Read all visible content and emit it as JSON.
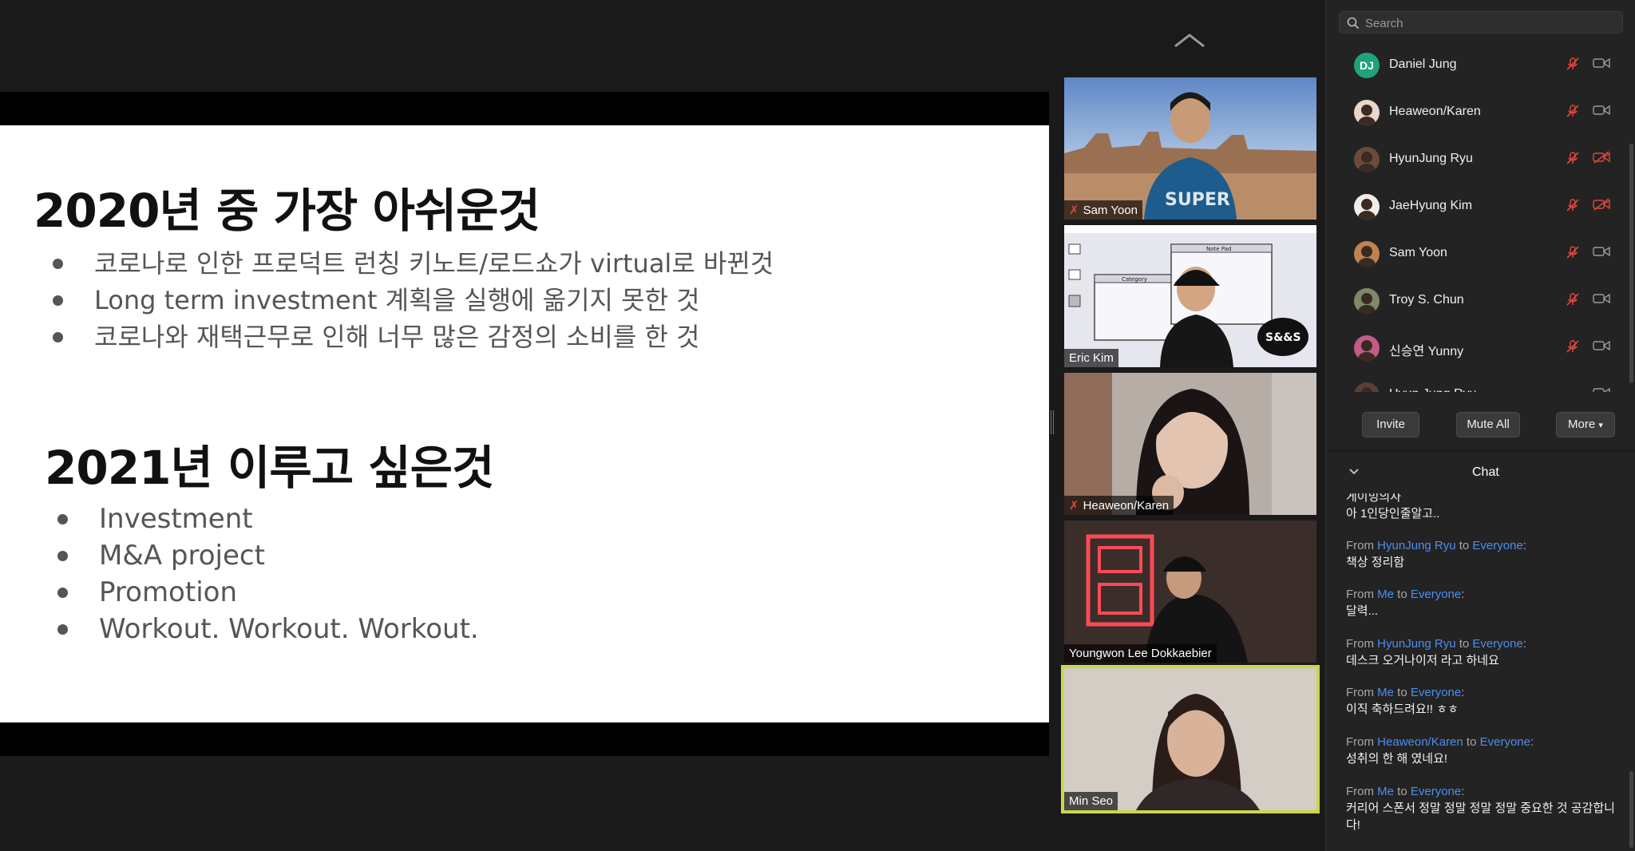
{
  "slide": {
    "heading1": "2020년 중 가장 아쉬운것",
    "bullets1": [
      "코로나로 인한 프로덕트 런칭 키노트/로드쇼가 virtual로 바뀐것",
      "Long term investment 계획을 실행에 옮기지 못한 것",
      "코로나와 재택근무로 인해 너무 많은 감정의 소비를 한 것"
    ],
    "heading2": "2021년 이루고 싶은것",
    "bullets2": [
      "Investment",
      "M&A project",
      "Promotion",
      "Workout. Workout. Workout."
    ]
  },
  "video_tiles": [
    {
      "name": "Sam Yoon",
      "muted": true
    },
    {
      "name": "Eric Kim",
      "muted": false
    },
    {
      "name": "Heaweon/Karen",
      "muted": true
    },
    {
      "name": "Youngwon Lee Dokkaebier",
      "muted": false
    },
    {
      "name": "Min Seo",
      "muted": false,
      "active_speaker": true
    }
  ],
  "eric_tile": {
    "sticker": "S&&S",
    "mock_window_title": "Note Pad",
    "mock_folder_title": "Category"
  },
  "participants_panel": {
    "search_placeholder": "Search",
    "participants": [
      {
        "name": "Daniel Jung",
        "initials": "DJ",
        "avatar_color": "#1fa37a",
        "video_off": false
      },
      {
        "name": "Heaweon/Karen",
        "video_off": false
      },
      {
        "name": "HyunJung Ryu",
        "video_off": true
      },
      {
        "name": "JaeHyung Kim",
        "video_off": true
      },
      {
        "name": "Sam Yoon",
        "video_off": false
      },
      {
        "name": "Troy S. Chun",
        "video_off": false
      },
      {
        "name": "신승연 Yunny",
        "video_off": false
      },
      {
        "name": "Hyun Jung Ryu",
        "video_off": false
      }
    ],
    "buttons": {
      "invite": "Invite",
      "mute_all": "Mute All",
      "more": "More"
    }
  },
  "chat": {
    "title": "Chat",
    "from_label": "From",
    "to_label": "to",
    "partial_top": [
      "게이밍의사",
      "아 1인당인줄알고.."
    ],
    "messages": [
      {
        "from": "HyunJung Ryu",
        "to": "Everyone",
        "text": "책상 정리함"
      },
      {
        "from": "Me",
        "to": "Everyone",
        "text": "달력..."
      },
      {
        "from": "HyunJung Ryu",
        "to": "Everyone",
        "text": "데스크 오거나이저 라고 하네요"
      },
      {
        "from": "Me",
        "to": "Everyone",
        "text": "이직 축하드려요!! ㅎㅎ"
      },
      {
        "from": "Heaweon/Karen",
        "to": "Everyone",
        "text": "성취의 한 해 였네요!"
      },
      {
        "from": "Me",
        "to": "Everyone",
        "text": "커리어 스폰서 정말 정말 정말 정말 중요한 것 공감합니다!"
      }
    ]
  },
  "colors": {
    "active_speaker_border": "#c9d84a",
    "chat_name_link": "#4d8ef0",
    "muted_icon": "#e0463c"
  }
}
